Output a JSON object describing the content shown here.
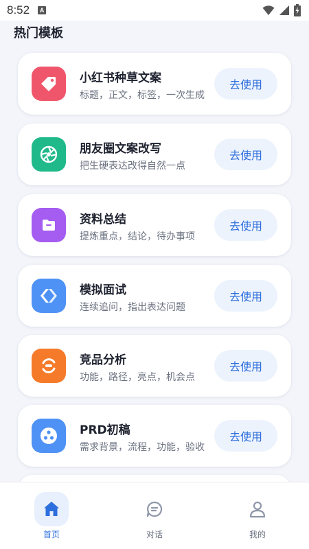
{
  "status_bar": {
    "time": "8:52",
    "app_icon_letter": "A"
  },
  "section_title": "热门模板",
  "templates": [
    {
      "title": "小红书种草文案",
      "desc": "标题，正文，标签，一次生成",
      "button": "去使用",
      "icon": "tag-icon",
      "color": "#f0566b"
    },
    {
      "title": "朋友圈文案改写",
      "desc": "把生硬表达改得自然一点",
      "button": "去使用",
      "icon": "aperture-icon",
      "color": "#1fb98a"
    },
    {
      "title": "资料总结",
      "desc": "提炼重点，结论，待办事项",
      "button": "去使用",
      "icon": "folder-icon",
      "color": "#a55cf0"
    },
    {
      "title": "模拟面试",
      "desc": "连续追问，指出表达问题",
      "button": "去使用",
      "icon": "code-brackets-icon",
      "color": "#4f92f5"
    },
    {
      "title": "竞品分析",
      "desc": "功能，路径，亮点，机会点",
      "button": "去使用",
      "icon": "sync-icon",
      "color": "#f57a2a"
    },
    {
      "title": "PRD初稿",
      "desc": "需求背景，流程，功能，验收",
      "button": "去使用",
      "icon": "dots-circle-icon",
      "color": "#4f92f5"
    }
  ],
  "bottom_nav": [
    {
      "label": "首页",
      "icon": "home-icon",
      "active": true
    },
    {
      "label": "对话",
      "icon": "chat-icon",
      "active": false
    },
    {
      "label": "我的",
      "icon": "user-icon",
      "active": false
    }
  ],
  "colors": {
    "accent": "#2d6fdc",
    "button_bg": "#edf3fd",
    "page_bg": "#f3f5fa"
  }
}
